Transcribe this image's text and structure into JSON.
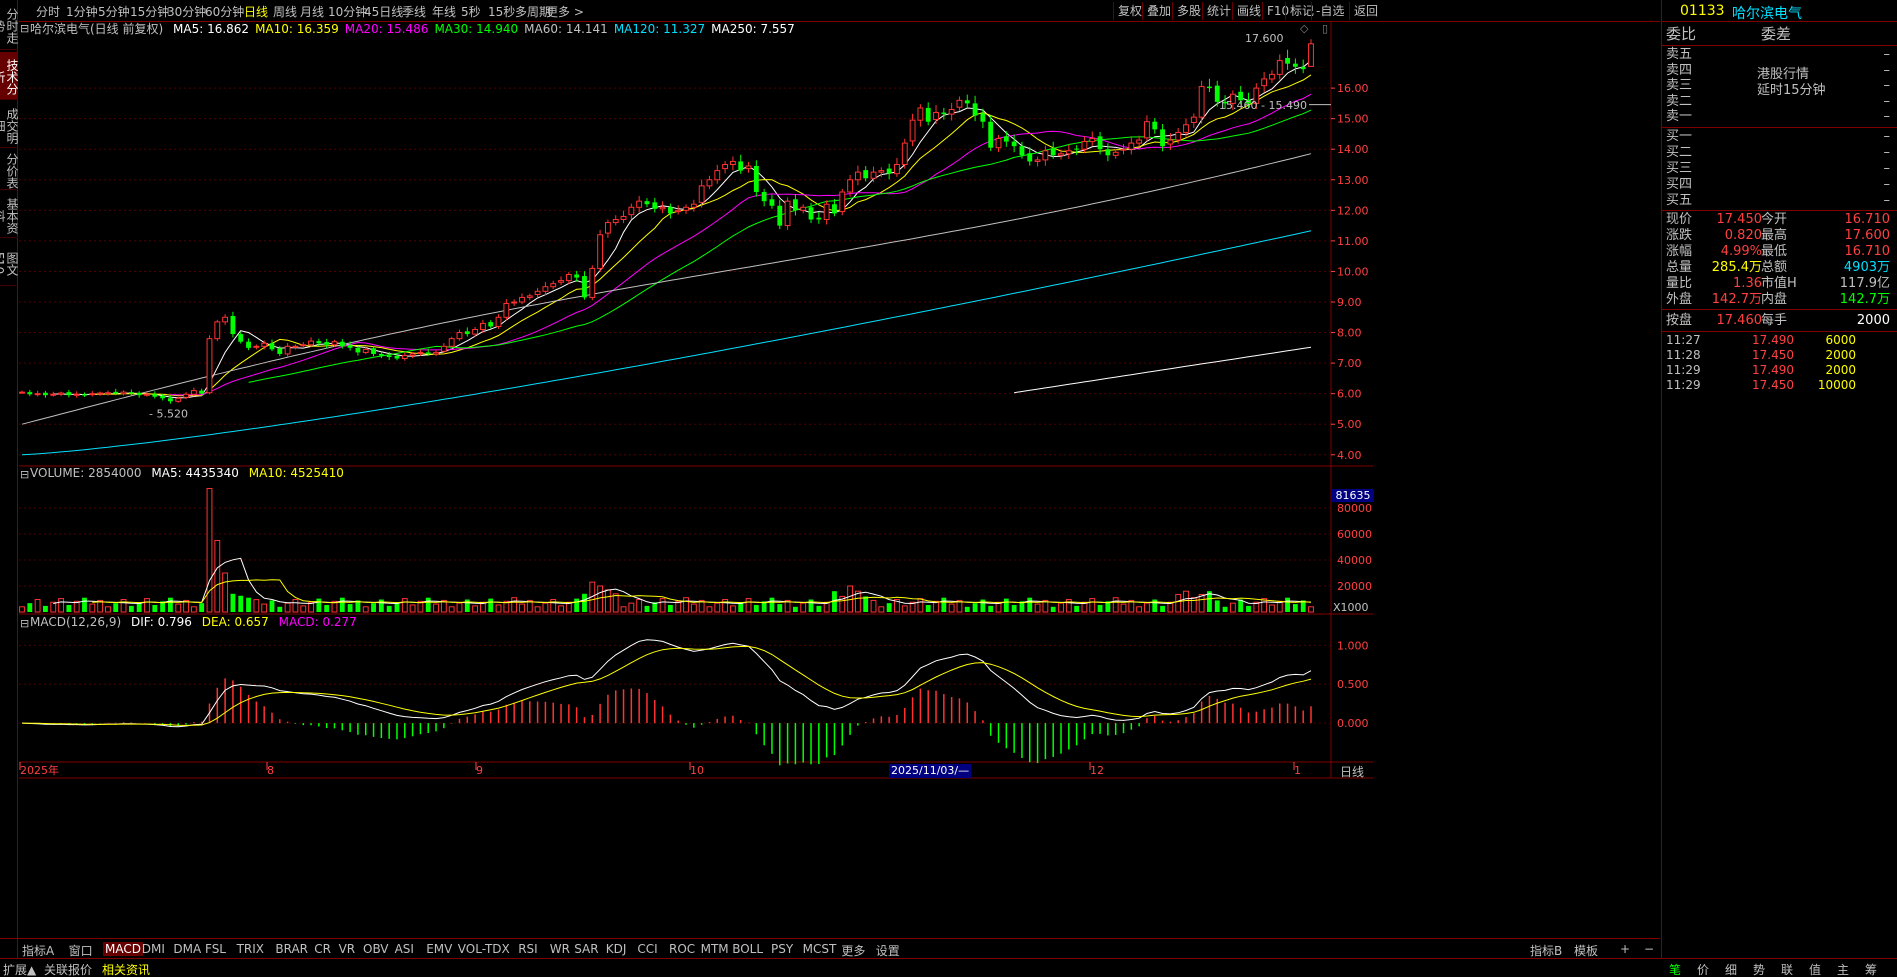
{
  "stock": {
    "code": "01133",
    "name": "哈尔滨电气"
  },
  "left_tabs": [
    "分时走势",
    "技术分析",
    "成交明细",
    "分价表",
    "基本资料",
    "图文F10"
  ],
  "timeframes": [
    "分时",
    "1分钟",
    "5分钟",
    "15分钟",
    "30分钟",
    "60分钟",
    "日线",
    "周线",
    "月线",
    "10分钟",
    "45日线",
    "季线",
    "年线",
    "5秒",
    "15秒",
    "多周期",
    "更多 >"
  ],
  "active_timeframe": "日线",
  "right_buttons": [
    "复权",
    "叠加",
    "多股",
    "统计",
    "画线",
    "F10",
    "标记",
    "-自选",
    "返回"
  ],
  "main_legend": {
    "title": "哈尔滨电气(日线 前复权)",
    "ma": [
      {
        "t": "MA5: 16.862",
        "c": "#ffffff"
      },
      {
        "t": "MA10: 16.359",
        "c": "#ffff00"
      },
      {
        "t": "MA20: 15.486",
        "c": "#ff00ff"
      },
      {
        "t": "MA30: 14.940",
        "c": "#00ff00"
      },
      {
        "t": "MA60: 14.141",
        "c": "#c0c0c0"
      },
      {
        "t": "MA120: 11.327",
        "c": "#00e0ff"
      },
      {
        "t": "MA250: 7.557",
        "c": "#ffffff"
      }
    ]
  },
  "price_axis": [
    "16.00",
    "15.00",
    "14.00",
    "13.00",
    "12.00",
    "11.00",
    "10.00",
    "9.00",
    "8.00",
    "7.00",
    "6.00",
    "5.00",
    "4.00"
  ],
  "annotations": {
    "high": "17.600",
    "low": "5.520",
    "range": "15.460 - 15.490"
  },
  "volume_legend": {
    "label": "VOLUME: 2854000",
    "ma5": "MA5: 4435340",
    "ma10": "MA10: 4525410"
  },
  "volume_axis": [
    "80000",
    "60000",
    "40000",
    "20000"
  ],
  "volume_box": "81635",
  "volume_unit": "X1000",
  "macd_legend": {
    "label": "MACD(12,26,9)",
    "dif": "DIF: 0.796",
    "dea": "DEA: 0.657",
    "macd": "MACD: 0.277"
  },
  "macd_axis": [
    "1.000",
    "0.500",
    "0.000"
  ],
  "date_axis": [
    {
      "t": "2025年",
      "x": 20
    },
    {
      "t": "8",
      "x": 267
    },
    {
      "t": "9",
      "x": 476
    },
    {
      "t": "10",
      "x": 690
    },
    {
      "t": "12",
      "x": 1090
    },
    {
      "t": "1",
      "x": 1294
    }
  ],
  "date_cursor": "2025/11/03/—",
  "period_label": "日线",
  "indicators": [
    "指标A",
    "窗口",
    "MACD",
    "DMI",
    "DMA",
    "FSL",
    "TRIX",
    "BRAR",
    "CR",
    "VR",
    "OBV",
    "ASI",
    "EMV",
    "VOL-TDX",
    "RSI",
    "WR",
    "SAR",
    "KDJ",
    "CCI",
    "ROC",
    "MTM",
    "BOLL",
    "PSY",
    "MCST",
    "更多",
    "设置"
  ],
  "active_indicator": "MACD",
  "indicator_right": [
    "指标B",
    "模板",
    "+",
    "−"
  ],
  "bottom_tabs": [
    "扩展▲",
    "关联报价",
    "相关资讯"
  ],
  "bottom_right": [
    "笔",
    "价",
    "细",
    "势",
    "联",
    "值",
    "主",
    "筹"
  ],
  "quote": {
    "header": [
      {
        "t": "委比",
        "c": "#c0c0c0"
      },
      {
        "t": "委差",
        "c": "#c0c0c0"
      }
    ],
    "sell": [
      "卖五",
      "卖四",
      "卖三",
      "卖二",
      "卖一"
    ],
    "buy": [
      "买一",
      "买二",
      "买三",
      "买四",
      "买五"
    ],
    "notice": [
      "港股行情",
      "延时15分钟"
    ],
    "dash": "–",
    "stats": [
      {
        "l1": "现价",
        "v1": "17.450",
        "c1": "#ff4040",
        "l2": "今开",
        "v2": "16.710",
        "c2": "#ff4040"
      },
      {
        "l1": "涨跌",
        "v1": "0.820",
        "c1": "#ff4040",
        "l2": "最高",
        "v2": "17.600",
        "c2": "#ff4040"
      },
      {
        "l1": "涨幅",
        "v1": "4.99%",
        "c1": "#ff4040",
        "l2": "最低",
        "v2": "16.710",
        "c2": "#ff4040"
      },
      {
        "l1": "总量",
        "v1": "285.4万",
        "c1": "#ffff00",
        "l2": "总额",
        "v2": "4903万",
        "c2": "#00e0ff"
      },
      {
        "l1": "量比",
        "v1": "1.36",
        "c1": "#ff4040",
        "l2": "市值H",
        "v2": "117.9亿",
        "c2": "#c0c0c0"
      },
      {
        "l1": "外盘",
        "v1": "142.7万",
        "c1": "#ff4040",
        "l2": "内盘",
        "v2": "142.7万",
        "c2": "#00ff00"
      }
    ],
    "extra": {
      "l1": "按盘",
      "v1": "17.460",
      "l2": "每手",
      "v2": "2000"
    },
    "ticks": [
      {
        "time": "11:27",
        "price": "17.490",
        "vol": "6000"
      },
      {
        "time": "11:28",
        "price": "17.450",
        "vol": "2000"
      },
      {
        "time": "11:29",
        "price": "17.490",
        "vol": "2000"
      },
      {
        "time": "11:29",
        "price": "17.450",
        "vol": "10000"
      }
    ]
  },
  "chart_data": {
    "type": "candlestick",
    "ylim": [
      3.6,
      18.0
    ],
    "closes": [
      6.05,
      5.98,
      6.0,
      5.95,
      5.98,
      6.02,
      5.95,
      5.98,
      5.94,
      6.0,
      6.02,
      6.03,
      6.0,
      6.05,
      6.0,
      5.95,
      5.98,
      5.9,
      5.85,
      5.75,
      5.85,
      5.98,
      6.1,
      6.0,
      7.8,
      8.35,
      8.5,
      7.95,
      7.7,
      7.5,
      7.55,
      7.65,
      7.45,
      7.3,
      7.55,
      7.55,
      7.6,
      7.72,
      7.65,
      7.6,
      7.7,
      7.55,
      7.5,
      7.35,
      7.45,
      7.3,
      7.25,
      7.2,
      7.15,
      7.25,
      7.3,
      7.35,
      7.3,
      7.35,
      7.55,
      7.8,
      8.0,
      7.95,
      8.1,
      8.3,
      8.2,
      8.5,
      8.95,
      9.0,
      9.15,
      9.2,
      9.35,
      9.5,
      9.6,
      9.7,
      9.9,
      9.8,
      9.15,
      10.1,
      11.2,
      11.6,
      11.7,
      11.8,
      12.1,
      12.3,
      12.2,
      12.05,
      12.1,
      11.9,
      12.0,
      12.1,
      12.2,
      12.8,
      13.0,
      13.3,
      13.5,
      13.6,
      13.3,
      13.45,
      12.6,
      12.3,
      12.15,
      11.5,
      12.3,
      12.0,
      12.1,
      11.7,
      11.7,
      12.2,
      11.9,
      12.6,
      13.0,
      13.25,
      13.05,
      13.25,
      13.3,
      13.2,
      13.5,
      14.2,
      14.95,
      15.35,
      14.9,
      15.2,
      15.15,
      15.3,
      15.6,
      15.5,
      15.1,
      14.9,
      14.05,
      14.35,
      14.25,
      14.1,
      13.8,
      13.6,
      13.65,
      13.95,
      13.8,
      13.85,
      13.95,
      14.0,
      14.25,
      14.35,
      14.0,
      13.8,
      13.9,
      14.0,
      14.2,
      14.3,
      14.9,
      14.65,
      14.1,
      14.3,
      14.55,
      14.8,
      15.05,
      16.05,
      16.0,
      15.55,
      15.5,
      15.8,
      15.6,
      15.5,
      16.0,
      16.3,
      16.45,
      16.9,
      16.8,
      16.7,
      16.62,
      17.45
    ],
    "series": [
      {
        "name": "MA5",
        "color": "#ffffff"
      },
      {
        "name": "MA10",
        "color": "#ffff00"
      },
      {
        "name": "MA20",
        "color": "#ff00ff"
      },
      {
        "name": "MA30",
        "color": "#00ff00"
      },
      {
        "name": "MA60",
        "color": "#c0c0c0"
      },
      {
        "name": "MA120",
        "color": "#00e0ff"
      },
      {
        "name": "MA250",
        "color": "#ffffff"
      }
    ],
    "volume_max": 100000,
    "macd_range": [
      -0.5,
      1.3
    ]
  }
}
